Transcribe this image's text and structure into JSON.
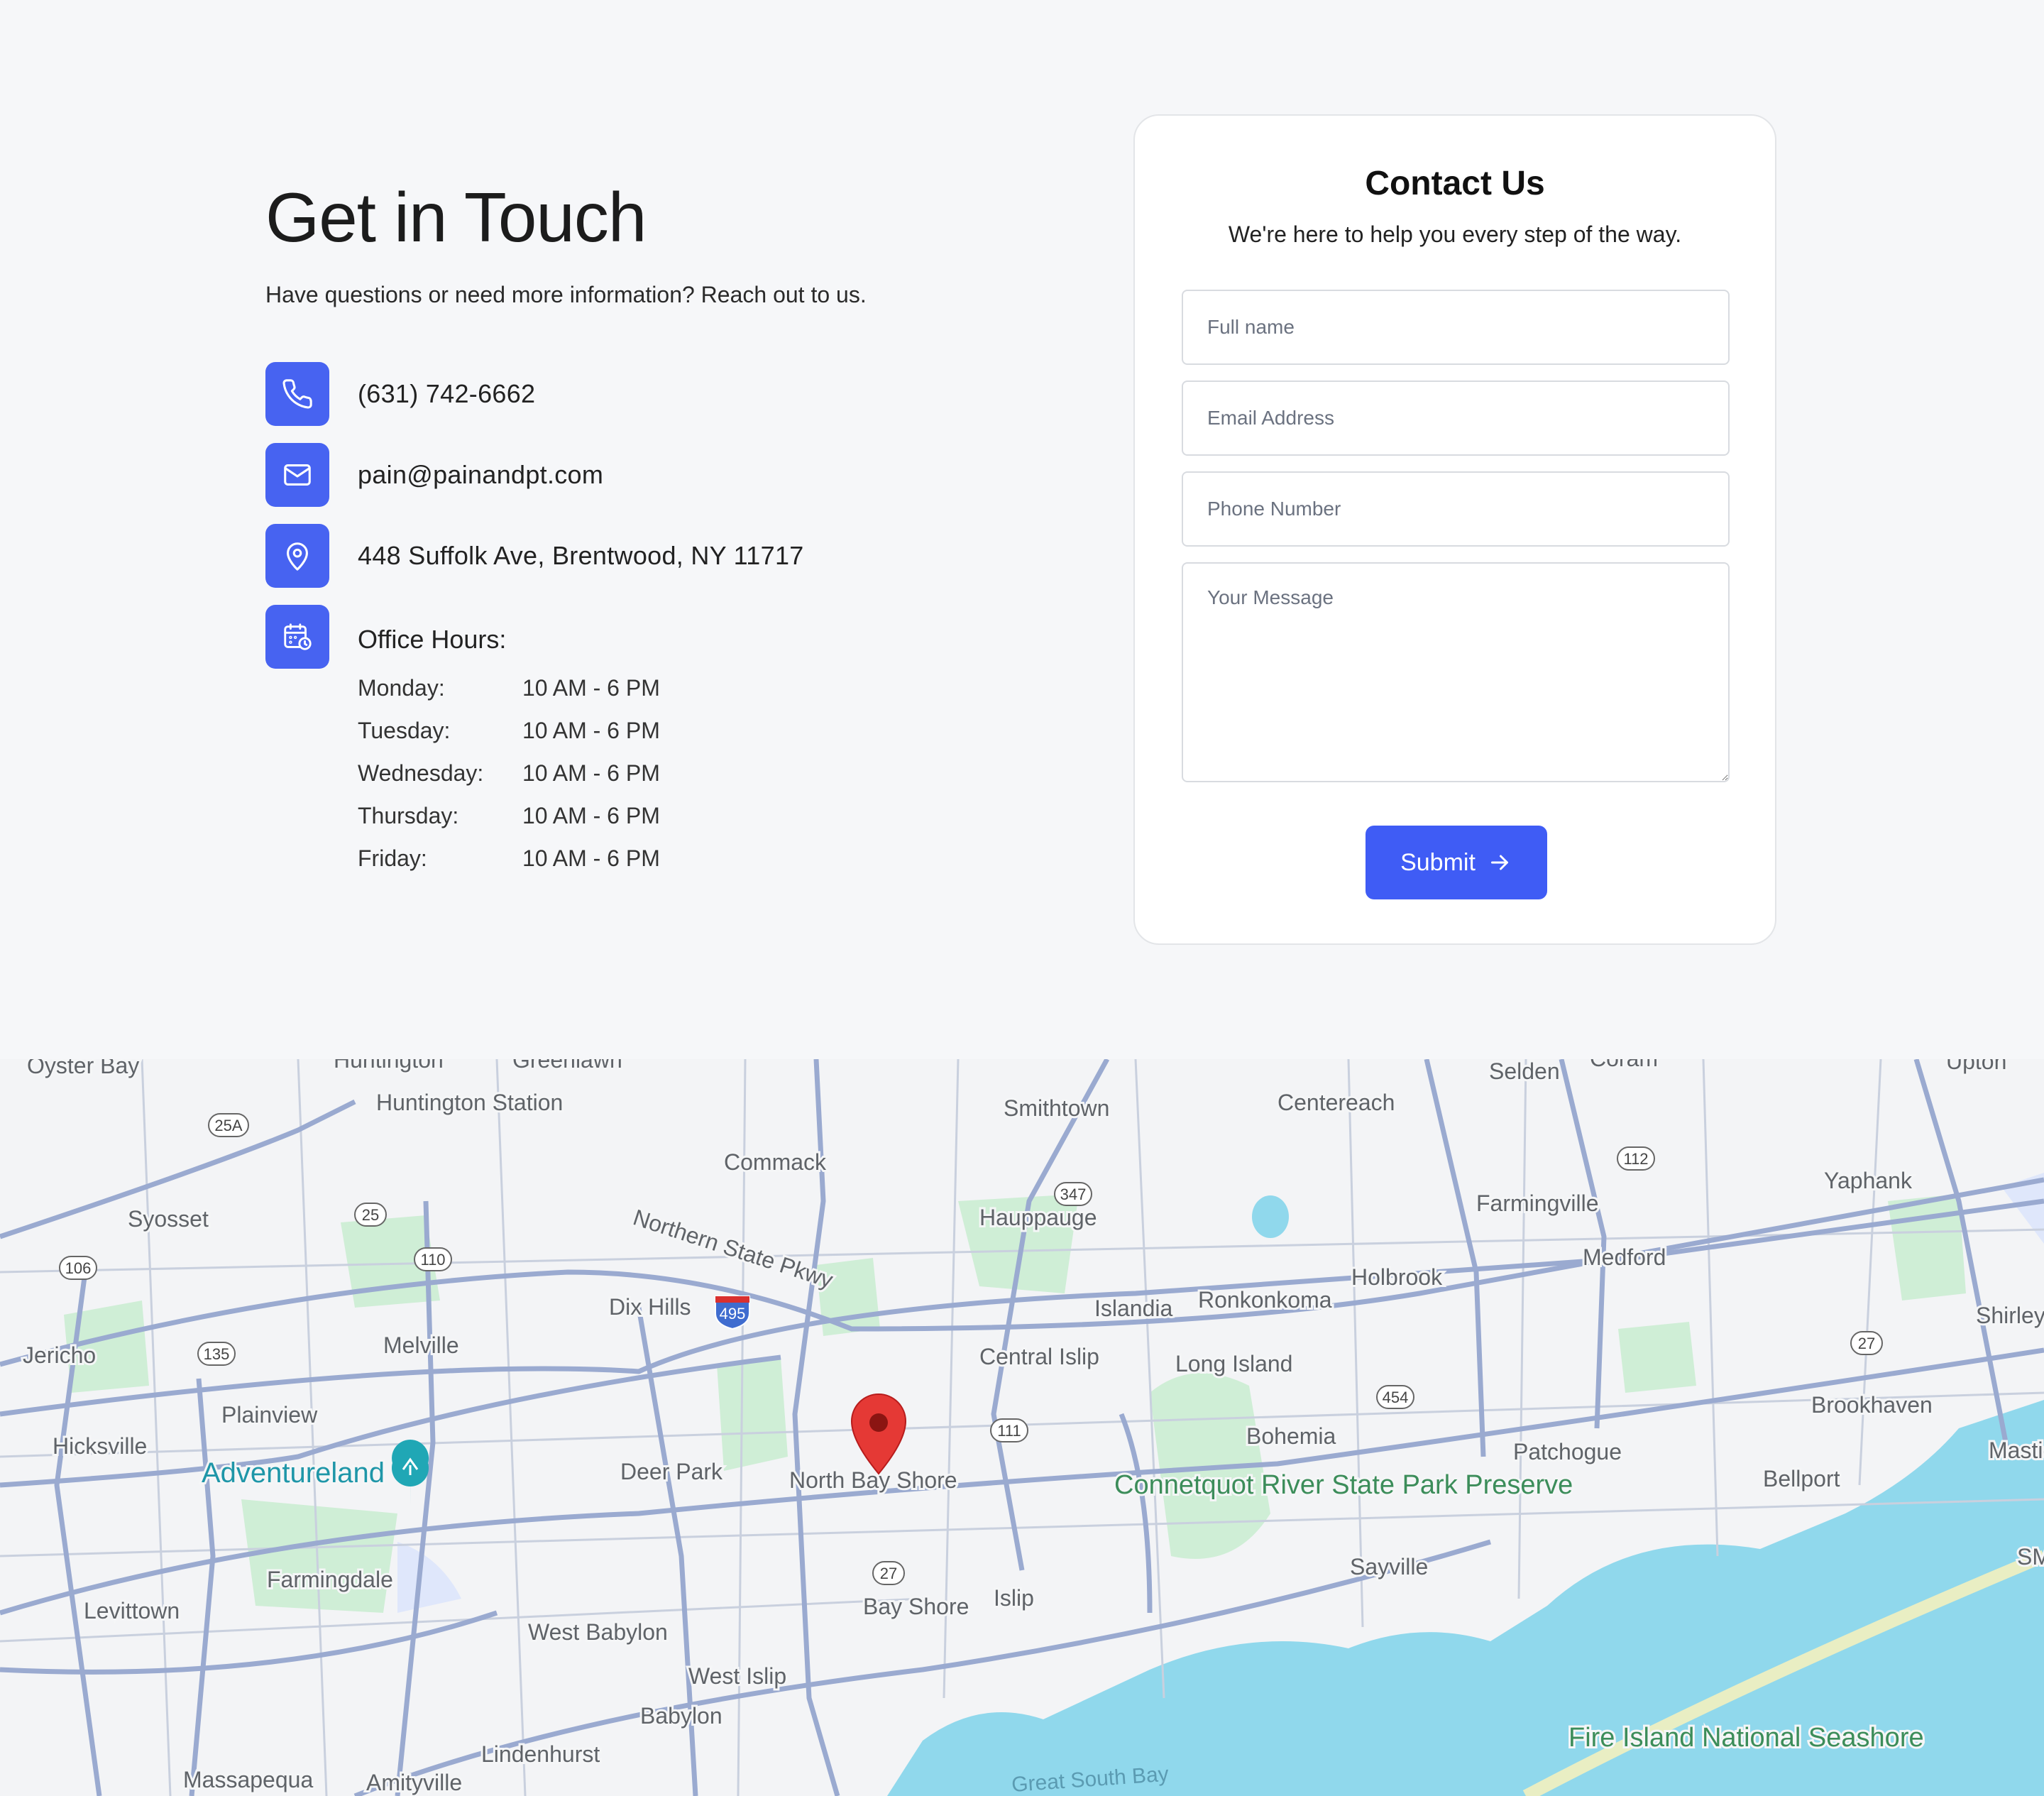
{
  "contact_section": {
    "title": "Get in Touch",
    "subtitle": "Have questions or need more information? Reach out to us.",
    "phone": "(631) 742-6662",
    "email": "pain@painandpt.com",
    "address": "448 Suffolk Ave, Brentwood, NY 11717",
    "hours_title": "Office Hours:",
    "hours": [
      {
        "day": "Monday:",
        "time": "10 AM - 6 PM"
      },
      {
        "day": "Tuesday:",
        "time": "10 AM - 6 PM"
      },
      {
        "day": "Wednesday:",
        "time": "10 AM - 6 PM"
      },
      {
        "day": "Thursday:",
        "time": "10 AM - 6 PM"
      },
      {
        "day": "Friday:",
        "time": "10 AM - 6 PM"
      }
    ],
    "icons": [
      "phone-icon",
      "mail-icon",
      "map-pin-icon",
      "calendar-clock-icon"
    ],
    "accent_color": "#4763f1"
  },
  "form": {
    "title": "Contact Us",
    "subtitle": "We're here to help you every step of the way.",
    "full_name_placeholder": "Full name",
    "email_placeholder": "Email Address",
    "phone_placeholder": "Phone Number",
    "message_placeholder": "Your Message",
    "submit_label": "Submit",
    "submit_color": "#3f5cf5"
  },
  "map": {
    "places": [
      "Oyster Bay",
      "Huntington",
      "Greenlawn",
      "Huntington Station",
      "Smithtown",
      "Centereach",
      "Selden",
      "Coram",
      "Upton",
      "Syosset",
      "Commack",
      "Hauppauge",
      "Farmingville",
      "Yaphank",
      "Medford",
      "Holbrook",
      "Dix Hills",
      "Islandia",
      "Ronkonkoma",
      "Shirley",
      "Jericho",
      "Melville",
      "Central Islip",
      "Long Island",
      "Plainview",
      "Hicksville",
      "Brookhaven",
      "Bohemia",
      "Patchogue",
      "Deer Park",
      "North Bay Shore",
      "Bellport",
      "Mastic",
      "Farmingdale",
      "Sayville",
      "Levittown",
      "West Babylon",
      "Bay Shore",
      "Islip",
      "West Islip",
      "Babylon",
      "Lindenhurst",
      "Massapequa",
      "Amityville",
      "SMI"
    ],
    "parks": [
      "Connetquot River State Park Preserve",
      "Fire Island National Seashore"
    ],
    "attraction": "Adventureland",
    "water": "Great South Bay",
    "road_label": "Northern State Pkwy",
    "shields": [
      "25A",
      "25",
      "106",
      "110",
      "135",
      "495",
      "111",
      "347",
      "112",
      "27",
      "454",
      "27",
      "25A",
      "25",
      "106",
      "110",
      "135",
      "111",
      "25A"
    ],
    "pin_color": "#e53935",
    "water_color": "#90d8ec"
  }
}
